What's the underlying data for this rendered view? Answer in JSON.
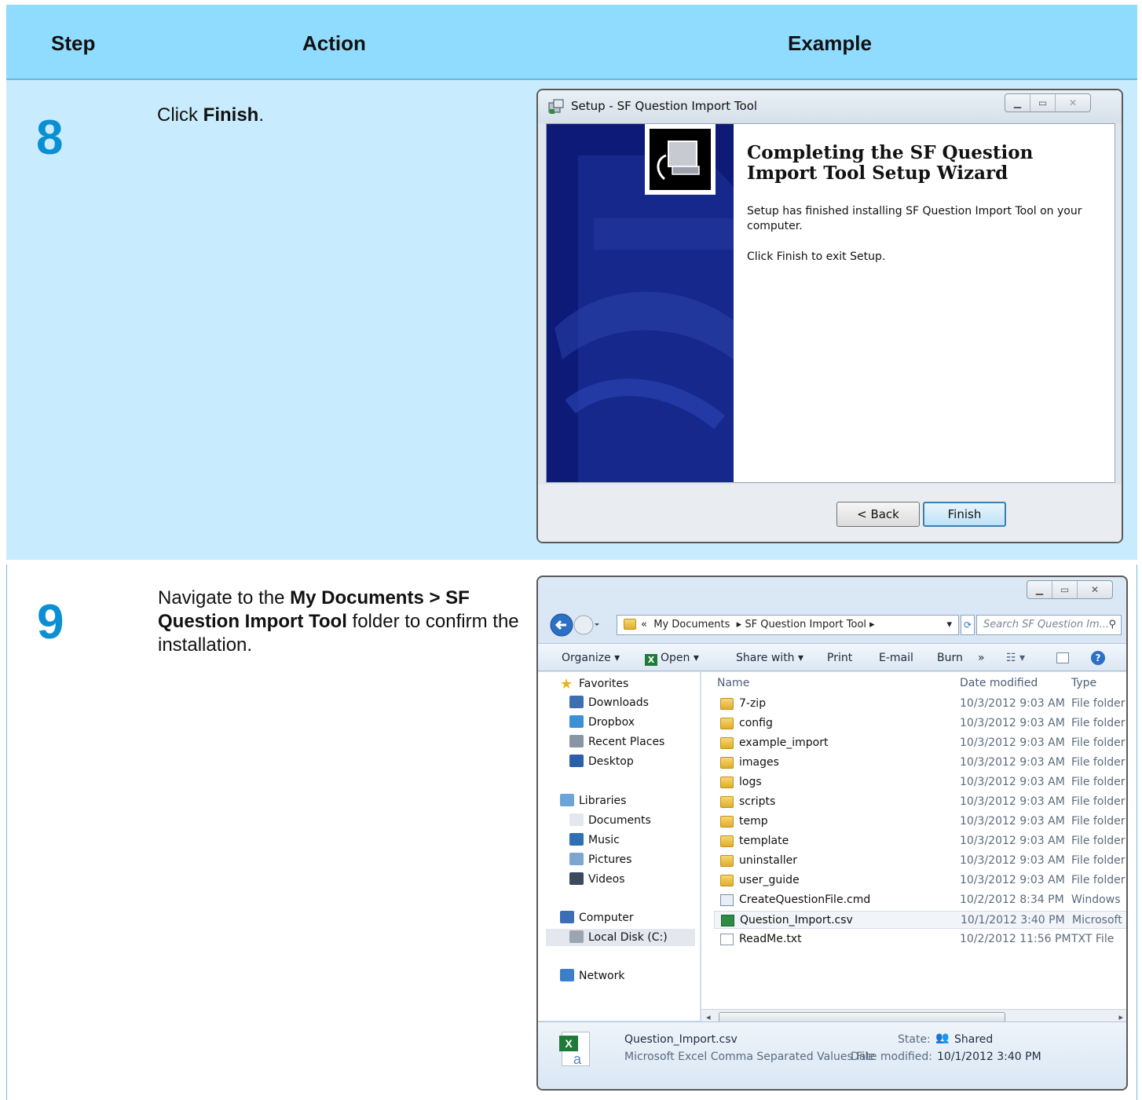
{
  "table": {
    "headers": {
      "step": "Step",
      "action": "Action",
      "example": "Example"
    }
  },
  "step8": {
    "number": "8",
    "action_pre": "Click ",
    "action_bold": "Finish",
    "action_post": ".",
    "window": {
      "title": "Setup - SF Question Import Tool",
      "heading": "Completing the SF Question Import Tool Setup Wizard",
      "text1": "Setup has finished installing SF Question Import Tool on your computer.",
      "text2": "Click Finish to exit Setup.",
      "back_button": "< Back",
      "finish_button": "Finish"
    }
  },
  "step9": {
    "number": "9",
    "action_pre": "Navigate to the ",
    "action_bold": "My Documents > SF Question Import Tool",
    "action_post": " folder to confirm the installation.",
    "explorer": {
      "address": {
        "prefix": "«",
        "part1": "My Documents",
        "part2": "SF Question Import Tool"
      },
      "search_placeholder": "Search SF Question Im...",
      "toolbar": [
        "Organize ▾",
        "Open ▾",
        "Share with ▾",
        "Print",
        "E-mail",
        "Burn",
        "»"
      ],
      "nav": {
        "favorites": "Favorites",
        "favorites_items": [
          "Downloads",
          "Dropbox",
          "Recent Places",
          "Desktop"
        ],
        "libraries": "Libraries",
        "libraries_items": [
          "Documents",
          "Music",
          "Pictures",
          "Videos"
        ],
        "computer": "Computer",
        "computer_items": [
          "Local Disk (C:)"
        ],
        "network": "Network"
      },
      "columns": {
        "name": "Name",
        "date": "Date modified",
        "type": "Type"
      },
      "files": [
        {
          "name": "7-zip",
          "date": "10/3/2012 9:03 AM",
          "type": "File folder",
          "kind": "folder"
        },
        {
          "name": "config",
          "date": "10/3/2012 9:03 AM",
          "type": "File folder",
          "kind": "folder"
        },
        {
          "name": "example_import",
          "date": "10/3/2012 9:03 AM",
          "type": "File folder",
          "kind": "folder"
        },
        {
          "name": "images",
          "date": "10/3/2012 9:03 AM",
          "type": "File folder",
          "kind": "folder"
        },
        {
          "name": "logs",
          "date": "10/3/2012 9:03 AM",
          "type": "File folder",
          "kind": "folder"
        },
        {
          "name": "scripts",
          "date": "10/3/2012 9:03 AM",
          "type": "File folder",
          "kind": "folder"
        },
        {
          "name": "temp",
          "date": "10/3/2012 9:03 AM",
          "type": "File folder",
          "kind": "folder"
        },
        {
          "name": "template",
          "date": "10/3/2012 9:03 AM",
          "type": "File folder",
          "kind": "folder"
        },
        {
          "name": "uninstaller",
          "date": "10/3/2012 9:03 AM",
          "type": "File folder",
          "kind": "folder"
        },
        {
          "name": "user_guide",
          "date": "10/3/2012 9:03 AM",
          "type": "File folder",
          "kind": "folder"
        },
        {
          "name": "CreateQuestionFile.cmd",
          "date": "10/2/2012 8:34 PM",
          "type": "Windows",
          "kind": "cmd"
        },
        {
          "name": "Question_Import.csv",
          "date": "10/1/2012 3:40 PM",
          "type": "Microsoft",
          "kind": "csv"
        },
        {
          "name": "ReadMe.txt",
          "date": "10/2/2012 11:56 PM",
          "type": "TXT File",
          "kind": "txt"
        }
      ],
      "details": {
        "filename": "Question_Import.csv",
        "filetype": "Microsoft Excel Comma Separated Values File",
        "state_label": "State:",
        "state_value": "Shared",
        "date_label": "Date modified:",
        "date_value": "10/1/2012 3:40 PM"
      }
    }
  }
}
